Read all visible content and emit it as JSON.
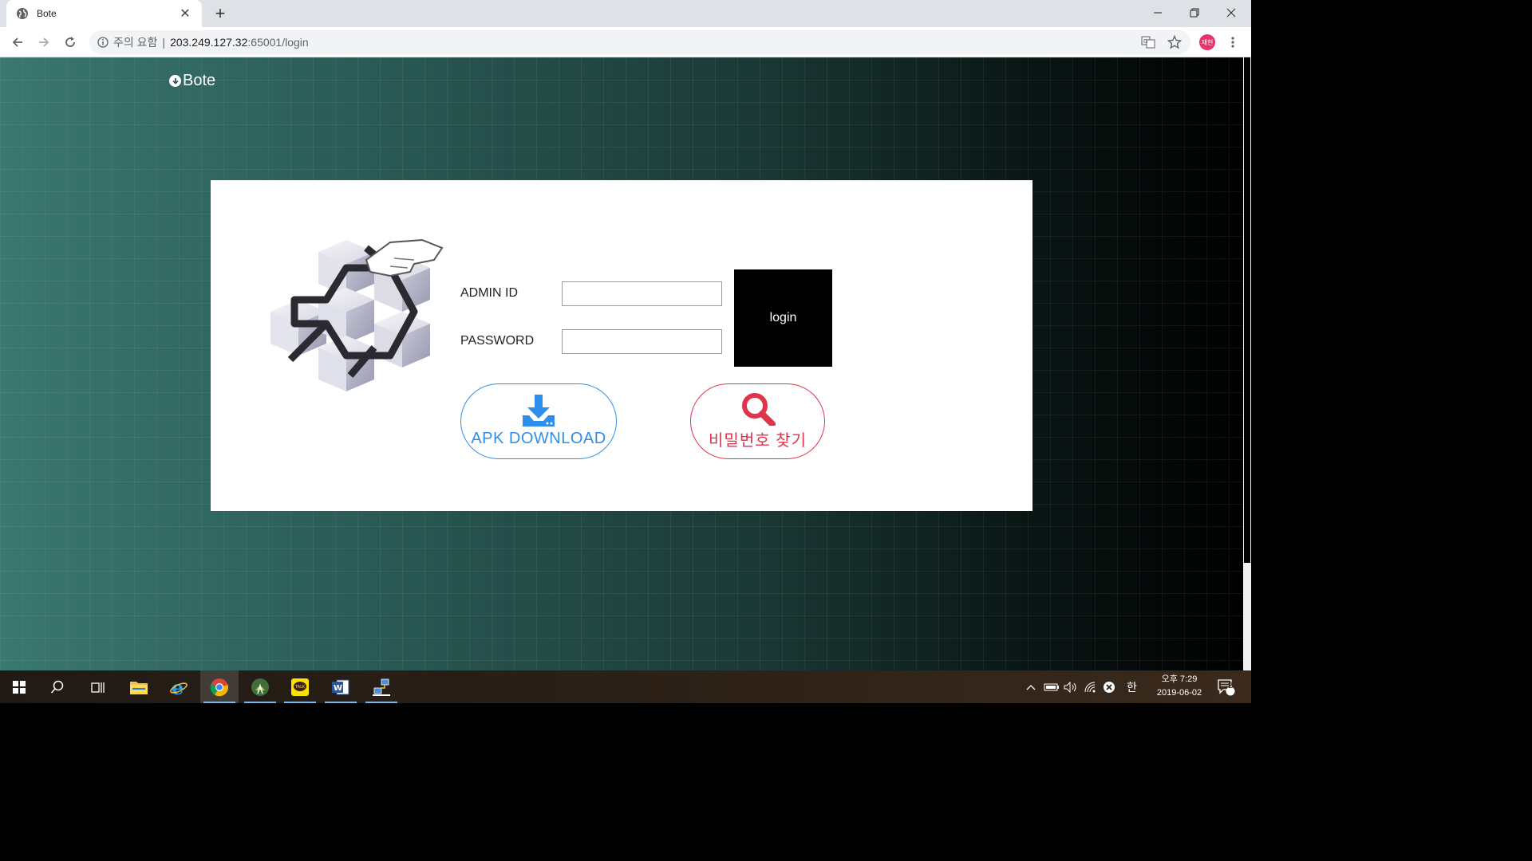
{
  "browser": {
    "tab_title": "Bote",
    "url_warning": "주의 요함",
    "url_host": "203.249.127.32",
    "url_path": ":65001/login",
    "profile_initials": "재헌"
  },
  "page": {
    "brand": "Bote",
    "admin_id_label": "ADMIN ID",
    "password_label": "PASSWORD",
    "admin_id_value": "",
    "password_value": "",
    "login_label": "login",
    "apk_label": "APK DOWNLOAD",
    "find_pw_label": "비밀번호 찾기"
  },
  "taskbar": {
    "ime": "한",
    "time": "오후 7:29",
    "date": "2019-06-02",
    "notifications": "2"
  },
  "colors": {
    "apk_blue": "#2f8eea",
    "pw_red": "#e0334d",
    "page_teal": "#3a7870"
  }
}
